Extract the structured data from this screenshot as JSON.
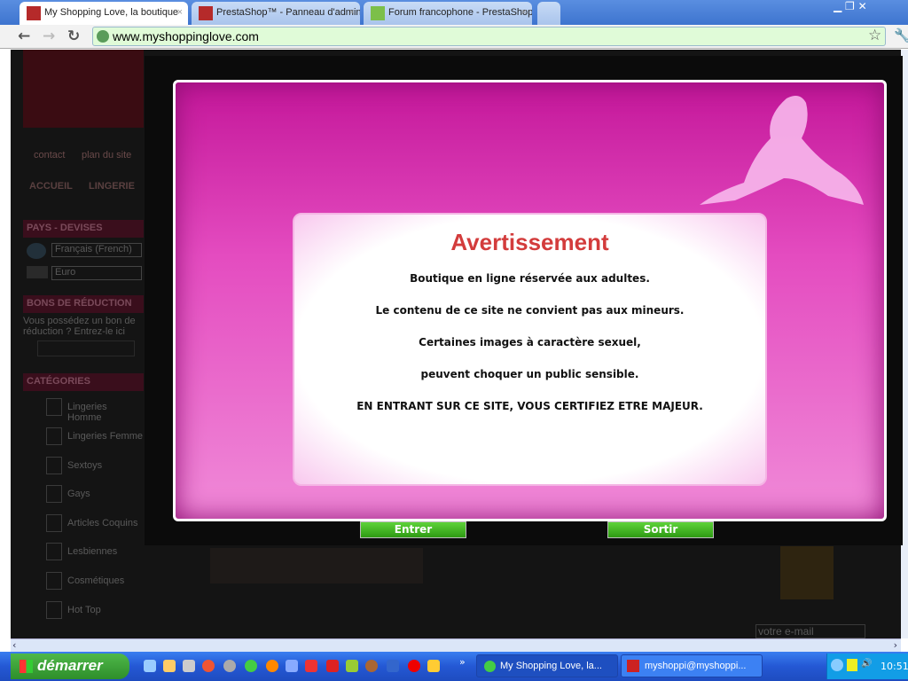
{
  "browser": {
    "tabs": [
      {
        "title": "My Shopping Love, la boutique",
        "active": true
      },
      {
        "title": "PrestaShop™ - Panneau d'admin"
      },
      {
        "title": "Forum francophone - PrestaShop"
      }
    ],
    "url": "www.myshoppinglove.com"
  },
  "site": {
    "top_links": [
      "contact",
      "plan du site"
    ],
    "menu": [
      "ACCUEIL",
      "LINGERIE"
    ],
    "currency_header": "PAYS - DEVISES",
    "language": "Français (French)",
    "currency": "Euro",
    "voucher_header": "BONS DE RÉDUCTION",
    "voucher_text": "Vous possédez un bon de réduction ? Entrez-le ici",
    "categories_header": "CATÉGORIES",
    "categories": [
      "Lingeries Homme",
      "Lingeries Femme",
      "Sextoys",
      "Gays",
      "Articles Coquins",
      "Lesbiennes",
      "Cosmétiques",
      "Hot Top"
    ],
    "newsletter_placeholder": "votre e-mail"
  },
  "modal": {
    "title": "Avertissement",
    "lines": [
      "Boutique en ligne réservée aux adultes.",
      "Le contenu de ce site ne convient pas aux mineurs.",
      "Certaines images à caractère sexuel,",
      "peuvent choquer un public sensible.",
      "EN ENTRANT SUR CE SITE, VOUS CERTIFIEZ ETRE MAJEUR."
    ],
    "enter_label": "Entrer",
    "exit_label": "Sortir"
  },
  "taskbar": {
    "start_label": "démarrer",
    "tasks": [
      "My Shopping Love, la...",
      "myshoppi@myshoppi..."
    ],
    "clock": "10:51"
  }
}
